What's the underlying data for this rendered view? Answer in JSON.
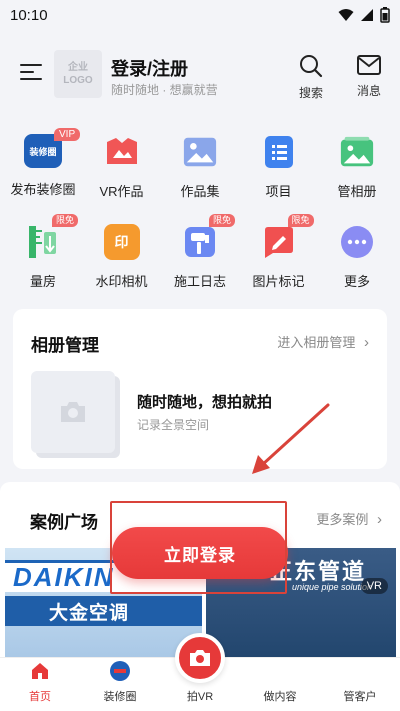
{
  "status_bar": {
    "time": "10:10"
  },
  "header": {
    "logo_line1": "企业",
    "logo_line2": "LOGO",
    "login_title": "登录/注册",
    "login_subtitle": "随时随地 · 想赢就营",
    "search_label": "搜索",
    "messages_label": "消息"
  },
  "grid": {
    "items": [
      {
        "label": "发布装修圈",
        "icon": "renovation-circle-icon",
        "badge": "VIP",
        "color": "#1f5fb8",
        "glyph": "装修圈"
      },
      {
        "label": "VR作品",
        "icon": "vr-works-icon",
        "color": "#f05656"
      },
      {
        "label": "作品集",
        "icon": "portfolio-icon",
        "color": "#7e9be6"
      },
      {
        "label": "项目",
        "icon": "project-icon",
        "color": "#3f82ee"
      },
      {
        "label": "管相册",
        "icon": "album-manage-icon",
        "color": "#47c37e"
      },
      {
        "label": "量房",
        "icon": "measure-room-icon",
        "badge": "限免",
        "color": "#38b56a"
      },
      {
        "label": "水印相机",
        "icon": "watermark-camera-icon",
        "color": "#f59a2e",
        "glyph": "印"
      },
      {
        "label": "施工日志",
        "icon": "construction-log-icon",
        "badge": "限免",
        "color": "#5d7ef0"
      },
      {
        "label": "图片标记",
        "icon": "image-mark-icon",
        "badge": "限免",
        "color": "#f05050"
      },
      {
        "label": "更多",
        "icon": "more-icon",
        "color": "#7d7ff2"
      }
    ]
  },
  "album_card": {
    "title": "相册管理",
    "link": "进入相册管理",
    "main_text": "随时随地，想拍就拍",
    "sub_text": "记录全景空间"
  },
  "cases": {
    "title": "案例广场",
    "link": "更多案例",
    "left_logo": "DAIKIN",
    "left_cn": "大金空调",
    "right_big": "正东管道",
    "right_small": "unique pipe solution",
    "vr_tag": "VR"
  },
  "cta": {
    "label": "立即登录"
  },
  "tabbar": {
    "tabs": [
      {
        "label": "首页",
        "icon": "home-icon",
        "active": true
      },
      {
        "label": "装修圈",
        "icon": "renovation-circle-tab-icon"
      },
      {
        "label": "拍VR",
        "icon": "camera-icon"
      },
      {
        "label": "做内容",
        "icon": "create-content-icon"
      },
      {
        "label": "管客户",
        "icon": "manage-customer-icon"
      }
    ]
  },
  "colors": {
    "accent": "#e63939",
    "annotation": "#d9433a"
  }
}
